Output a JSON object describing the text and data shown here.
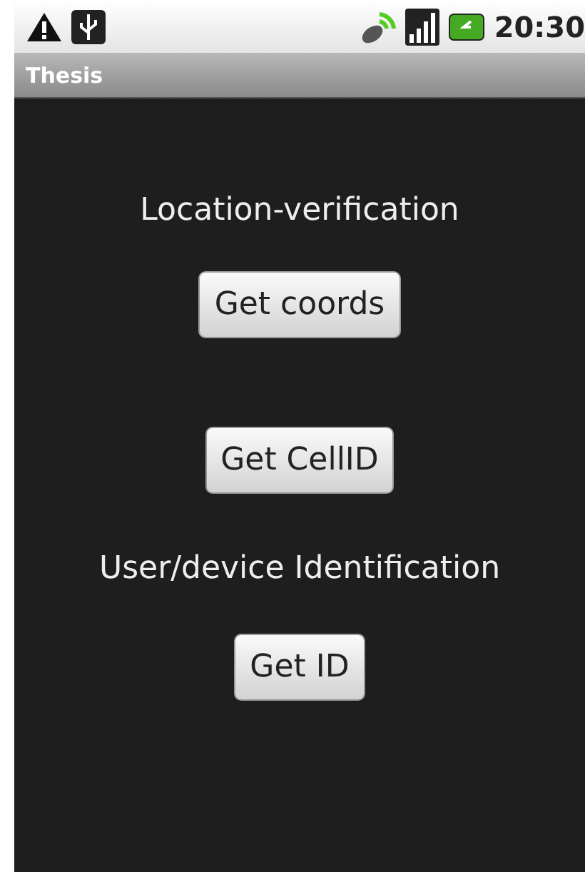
{
  "status_bar": {
    "time": "20:30"
  },
  "title_bar": {
    "title": "Thesis"
  },
  "content": [
    {
      "kind": "label",
      "text": "Location-verification"
    },
    {
      "kind": "button",
      "text": "Get coords"
    },
    {
      "kind": "button",
      "text": "Get CellID"
    },
    {
      "kind": "label",
      "text": "User/device Identification"
    },
    {
      "kind": "button",
      "text": "Get ID"
    }
  ]
}
